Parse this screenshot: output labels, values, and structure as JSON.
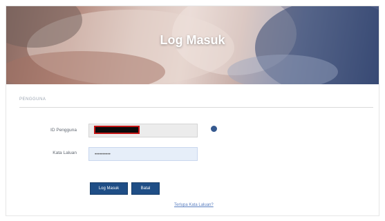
{
  "hero": {
    "title": "Log Masuk"
  },
  "section": {
    "label": "PENGGUNA"
  },
  "form": {
    "user_label": "ID Pengguna",
    "user_value": "",
    "password_label": "Kata Laluan",
    "password_value": "••••••••••"
  },
  "buttons": {
    "login_label": "Log Masuk",
    "cancel_label": "Batal"
  },
  "links": {
    "forgot_password": "Terlupa Kata Laluan?"
  },
  "colors": {
    "accent": "#1f4e86",
    "link": "#5a7fc0",
    "redaction_border": "#c41616"
  }
}
